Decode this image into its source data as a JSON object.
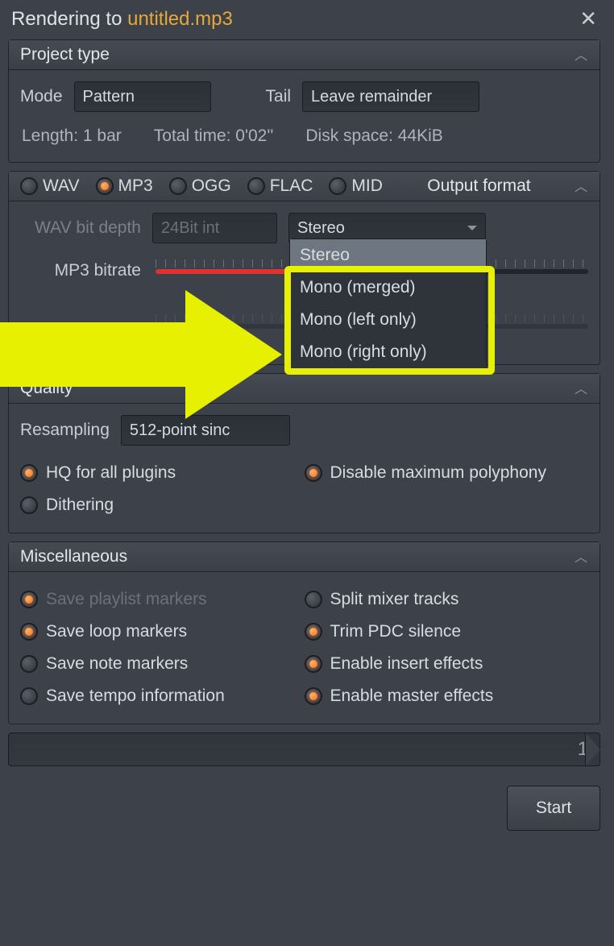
{
  "title_prefix": "Rendering to ",
  "filename": "untitled.mp3",
  "panels": {
    "project": {
      "title": "Project type",
      "mode_label": "Mode",
      "mode_value": "Pattern",
      "tail_label": "Tail",
      "tail_value": "Leave remainder",
      "length": "Length: 1 bar",
      "total_time": "Total time: 0'02''",
      "disk_space": "Disk space: 44KiB"
    },
    "output": {
      "title": "Output format",
      "formats": [
        "WAV",
        "MP3",
        "OGG",
        "FLAC",
        "MID"
      ],
      "selected_format": "MP3",
      "wav_depth_label": "WAV bit depth",
      "wav_depth_value": "24Bit int",
      "channel_value": "Stereo",
      "channel_options": [
        "Stereo",
        "Mono (merged)",
        "Mono (left only)",
        "Mono (right only)"
      ],
      "bitrate_label": "MP3 bitrate"
    },
    "quality": {
      "title": "Quality",
      "resampling_label": "Resampling",
      "resampling_value": "512-point sinc",
      "hq": "HQ for all plugins",
      "dithering": "Dithering",
      "disable_poly": "Disable maximum polyphony"
    },
    "misc": {
      "title": "Miscellaneous",
      "save_playlist": "Save playlist markers",
      "save_loop": "Save loop markers",
      "save_note": "Save note markers",
      "save_tempo": "Save tempo information",
      "split_mixer": "Split mixer tracks",
      "trim_pdc": "Trim PDC silence",
      "enable_insert": "Enable insert effects",
      "enable_master": "Enable master effects"
    }
  },
  "progress_value": "1",
  "start_label": "Start"
}
